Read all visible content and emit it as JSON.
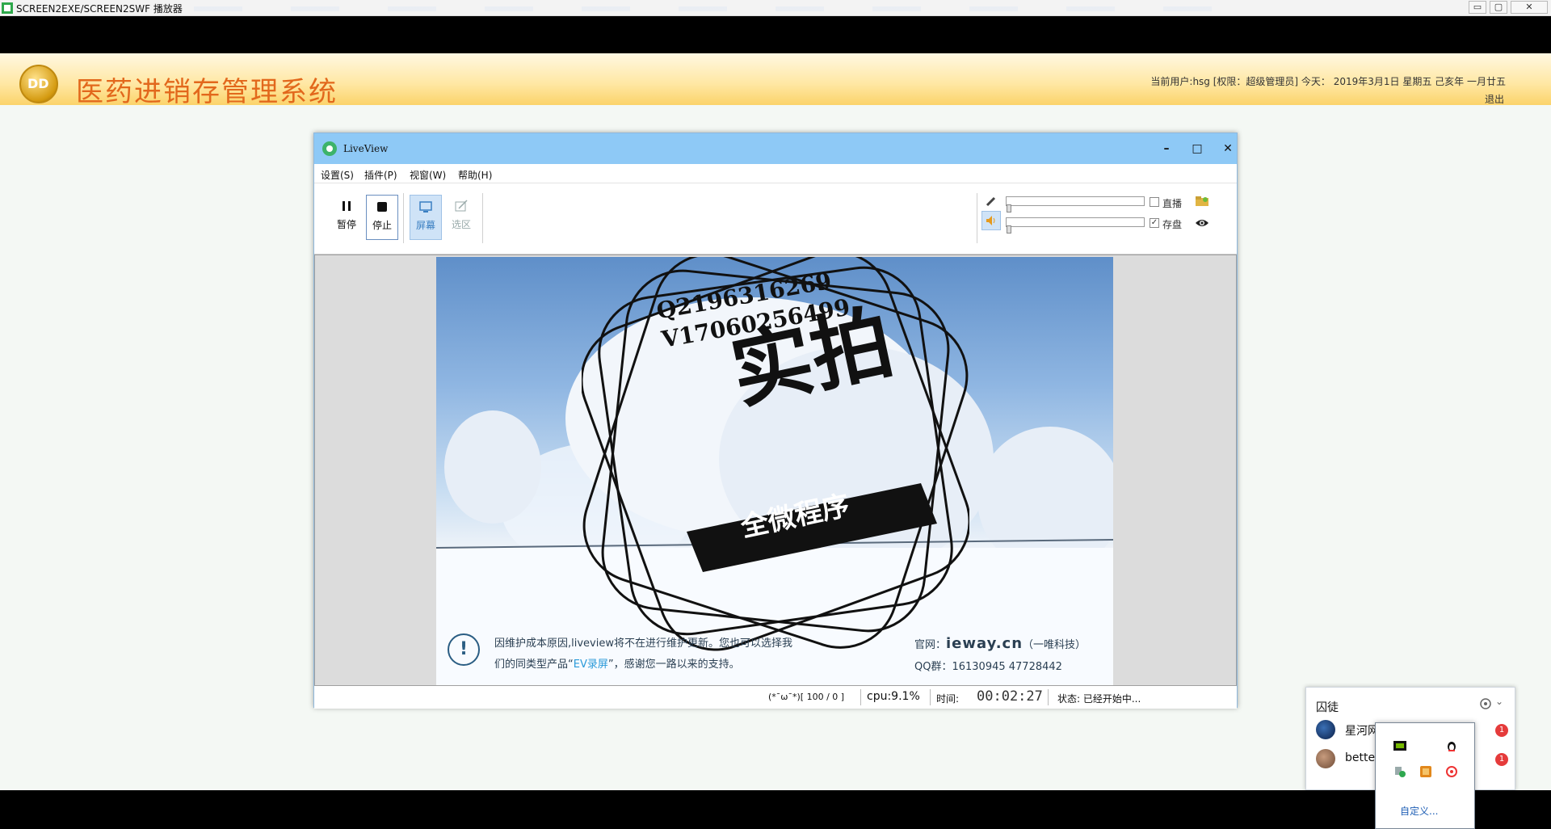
{
  "player": {
    "title": "SCREEN2EXE/SCREEN2SWF 播放器",
    "controls": [
      "▭",
      "▢",
      "✕"
    ]
  },
  "app": {
    "logo_text": "DD",
    "title": "医药进销存管理系统",
    "user_info": "当前用户:hsg [权限：超级管理员] 今天： 2019年3月1日 星期五 己亥年 一月廿五",
    "logout": "退出"
  },
  "liveview": {
    "title": "LiveView",
    "menu": [
      "设置(S)",
      "插件(P)",
      "视窗(W)",
      "帮助(H)"
    ],
    "toolbar": {
      "pause": "暂停",
      "stop": "停止",
      "screen": "屏幕",
      "region": "选区"
    },
    "options": {
      "live": "直播",
      "save": "存盘",
      "live_checked": false,
      "save_checked": true
    },
    "video": {
      "watermark_id1": "Q2196316269",
      "watermark_id2": "V17060256499",
      "stamp_main": "实拍",
      "stamp_sub": "全微程序",
      "notice_line1": "因维护成本原因,liveview将不在进行维护更新。您也可以选择我",
      "notice_line2_pre": "们的同类型产品“",
      "notice_line2_link": "EV录屏",
      "notice_line2_post": "”，感谢您一路以来的支持。",
      "site_label": "官网：",
      "site": "ieway.cn",
      "site_note": "（一唯科技）",
      "qq_group": "QQ群：16130945  47728442"
    },
    "status": {
      "face": "(*ˉωˉ*)[ 100 / 0 ]",
      "cpu": "cpu:9.1%",
      "time_label": "时间:",
      "time": "00:02:27",
      "state": "状态:  已经开始中..."
    }
  },
  "qq": {
    "header": "囚徒",
    "rows": [
      {
        "name": "星河网",
        "badge": "1"
      },
      {
        "name": "bette",
        "badge": "1"
      }
    ],
    "tray_customize": "自定义..."
  },
  "colors": {
    "app_title": "#e2681c",
    "titlebar_blue": "#8ec9f6",
    "link_blue": "#2b9ad9"
  }
}
